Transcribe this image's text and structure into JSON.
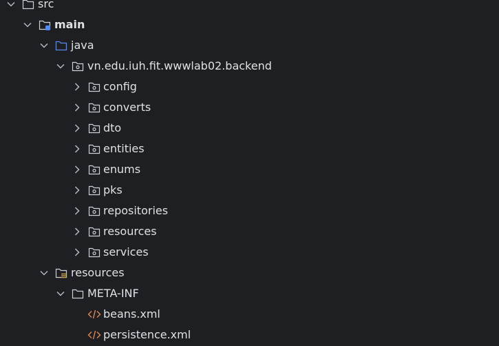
{
  "colors": {
    "background": "#1e1f22",
    "text": "#dfe1e5",
    "chevron": "#b4b8bf",
    "folder": "#ced0d6",
    "source_folder": "#548af7",
    "xml_icon": "#e08855"
  },
  "tree": {
    "src": {
      "label": "src",
      "expanded": true
    },
    "main": {
      "label": "main",
      "expanded": true
    },
    "java": {
      "label": "java",
      "expanded": true
    },
    "package": {
      "label": "vn.edu.iuh.fit.wwwlab02.backend",
      "expanded": true
    },
    "packages": [
      {
        "label": "config",
        "expanded": false
      },
      {
        "label": "converts",
        "expanded": false
      },
      {
        "label": "dto",
        "expanded": false
      },
      {
        "label": "entities",
        "expanded": false
      },
      {
        "label": "enums",
        "expanded": false
      },
      {
        "label": "pks",
        "expanded": false
      },
      {
        "label": "repositories",
        "expanded": false
      },
      {
        "label": "resources",
        "expanded": false
      },
      {
        "label": "services",
        "expanded": false
      }
    ],
    "resources": {
      "label": "resources",
      "expanded": true
    },
    "meta_inf": {
      "label": "META-INF",
      "expanded": true
    },
    "files": [
      {
        "label": "beans.xml",
        "icon": "xml-file-icon"
      },
      {
        "label": "persistence.xml",
        "icon": "xml-file-icon"
      }
    ]
  }
}
